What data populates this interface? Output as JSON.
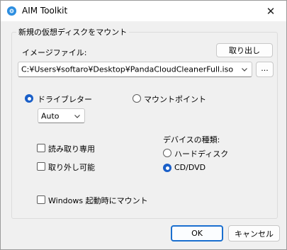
{
  "window": {
    "title": "AIM Toolkit",
    "close_glyph": "✕"
  },
  "group": {
    "title": "新規の仮想ディスクをマウント"
  },
  "image_file": {
    "label": "イメージファイル:",
    "eject_label": "取り出し",
    "path": "C:¥Users¥softaro¥Desktop¥PandaCloudCleanerFull.iso",
    "browse_label": "..."
  },
  "mount_target": {
    "drive_letter_label": "ドライブレター",
    "drive_letter_selected": true,
    "drive_letter_value": "Auto",
    "mount_point_label": "マウントポイント",
    "mount_point_selected": false
  },
  "options": {
    "read_only_label": "読み取り専用",
    "read_only_checked": false,
    "removable_label": "取り外し可能",
    "removable_checked": false,
    "mount_on_startup_label": "Windows 起動時にマウント",
    "mount_on_startup_checked": false
  },
  "device_type": {
    "label": "デバイスの種類:",
    "hard_disk_label": "ハードディスク",
    "hard_disk_selected": false,
    "cd_dvd_label": "CD/DVD",
    "cd_dvd_selected": true
  },
  "footer": {
    "ok_label": "OK",
    "cancel_label": "キャンセル"
  },
  "colors": {
    "accent": "#1a5fc8",
    "titlebar": "#ffffff",
    "background": "#f0f0f0"
  },
  "icons": {
    "app": "cloud-disk-icon",
    "close": "close-icon",
    "dropdown": "chevron-down-icon"
  }
}
